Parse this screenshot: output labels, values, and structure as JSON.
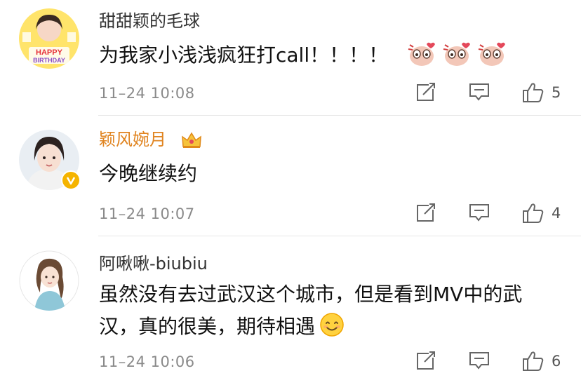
{
  "comments": [
    {
      "username": "甜甜颖的毛球",
      "text": "为我家小浅浅疯狂打call！！！！",
      "time": "11–24 10:08",
      "likes": "5",
      "avatar_caption": "HAPPY BIRTHDAY",
      "avatar_caption_line1": "HAPPY",
      "avatar_caption_line2": "BIRTHDAY",
      "sticker_count": 3
    },
    {
      "username": "颖风婉月",
      "text": "今晚继续约",
      "time": "11–24 10:07",
      "likes": "4",
      "verified": true,
      "vip_crown": true
    },
    {
      "username": "阿啾啾-biubiu",
      "text": "虽然没有去过武汉这个城市，但是看到MV中的武汉，真的很美，期待相遇",
      "time": "11–24 10:06",
      "likes": "6",
      "inline_emoji": "smile"
    }
  ],
  "colors": {
    "gold_username": "#e08420",
    "verified_badge": "#f5b400",
    "meta_text": "#8a8a8a",
    "divider": "#e6e6e6"
  },
  "icons": [
    "forward-icon",
    "comment-icon",
    "like-icon",
    "verified-badge-icon",
    "crown-icon",
    "smile-emoji-icon",
    "sticker-icon"
  ]
}
